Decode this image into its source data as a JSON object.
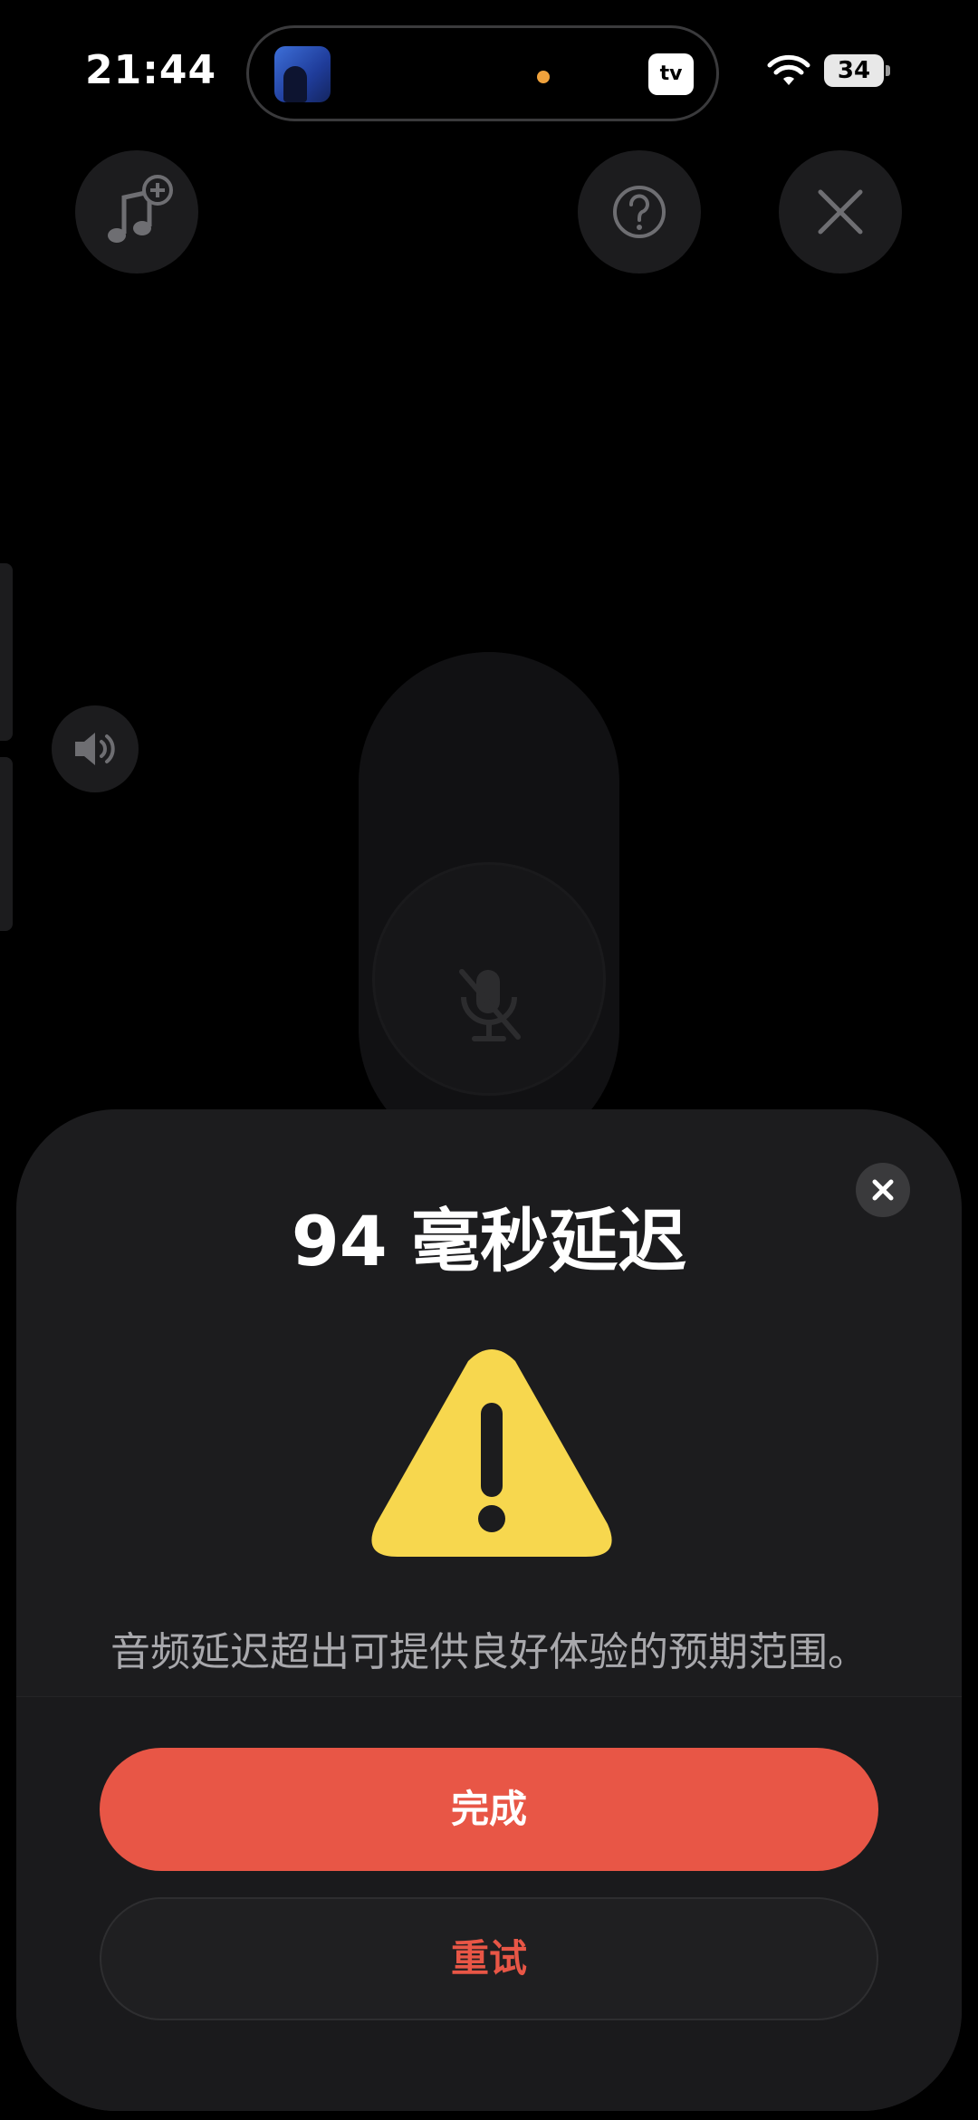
{
  "status_bar": {
    "time": "21:44",
    "battery_level": "34",
    "live_activity_app_label": "tv",
    "icons": [
      "album-art-thumbnail",
      "recording-indicator-dot",
      "apple-tv-icon",
      "wifi-icon",
      "battery-icon"
    ]
  },
  "top_controls": {
    "icons": [
      "add-music-icon",
      "help-icon",
      "close-icon"
    ]
  },
  "side_controls": {
    "icons": [
      "speaker-icon"
    ]
  },
  "mic_control": {
    "icon": "mic-muted-icon",
    "state": "muted"
  },
  "sheet": {
    "title": "94 毫秒延迟",
    "warning_icon": "warning-triangle-icon",
    "message": "音频延迟超出可提供良好体验的预期范围。",
    "primary_button_label": "完成",
    "secondary_button_label": "重试",
    "close_icon": "close-icon"
  },
  "colors": {
    "background": "#000000",
    "sheet_background": "#1c1c1e",
    "accent_red": "#e85646",
    "warning_yellow": "#f7d74e",
    "recording_dot": "#f0a23c"
  }
}
